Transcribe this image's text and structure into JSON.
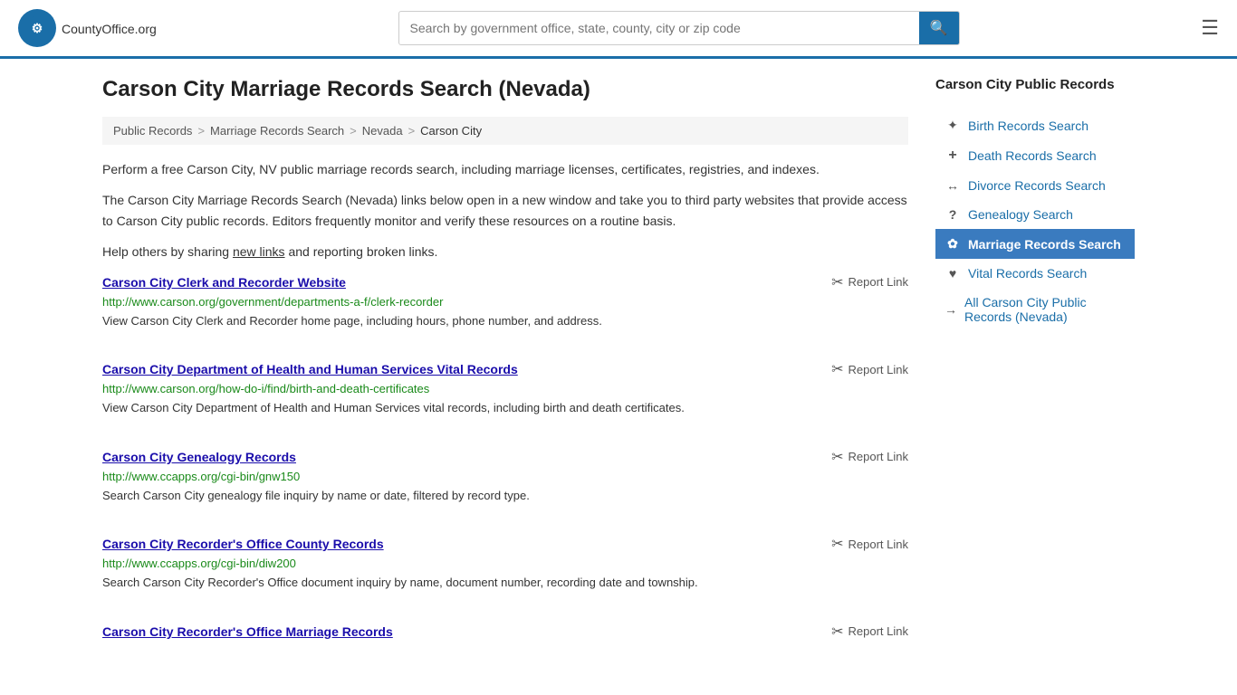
{
  "header": {
    "logo_text": "CountyOffice",
    "logo_suffix": ".org",
    "search_placeholder": "Search by government office, state, county, city or zip code"
  },
  "page": {
    "title": "Carson City Marriage Records Search (Nevada)",
    "breadcrumb": [
      {
        "label": "Public Records",
        "href": "#"
      },
      {
        "label": "Marriage Records Search",
        "href": "#"
      },
      {
        "label": "Nevada",
        "href": "#"
      },
      {
        "label": "Carson City",
        "href": "#",
        "current": true
      }
    ],
    "description1": "Perform a free Carson City, NV public marriage records search, including marriage licenses, certificates, registries, and indexes.",
    "description2": "The Carson City Marriage Records Search (Nevada) links below open in a new window and take you to third party websites that provide access to Carson City public records. Editors frequently monitor and verify these resources on a routine basis.",
    "description3_pre": "Help others by sharing ",
    "description3_link": "new links",
    "description3_post": " and reporting broken links."
  },
  "results": [
    {
      "title": "Carson City Clerk and Recorder Website",
      "url": "http://www.carson.org/government/departments-a-f/clerk-recorder",
      "description": "View Carson City Clerk and Recorder home page, including hours, phone number, and address.",
      "report": "Report Link"
    },
    {
      "title": "Carson City Department of Health and Human Services Vital Records",
      "url": "http://www.carson.org/how-do-i/find/birth-and-death-certificates",
      "description": "View Carson City Department of Health and Human Services vital records, including birth and death certificates.",
      "report": "Report Link"
    },
    {
      "title": "Carson City Genealogy Records",
      "url": "http://www.ccapps.org/cgi-bin/gnw150",
      "description": "Search Carson City genealogy file inquiry by name or date, filtered by record type.",
      "report": "Report Link"
    },
    {
      "title": "Carson City Recorder's Office County Records",
      "url": "http://www.ccapps.org/cgi-bin/diw200",
      "description": "Search Carson City Recorder's Office document inquiry by name, document number, recording date and township.",
      "report": "Report Link"
    },
    {
      "title": "Carson City Recorder's Office Marriage Records",
      "url": "",
      "description": "",
      "report": "Report Link"
    }
  ],
  "sidebar": {
    "title": "Carson City Public Records",
    "items": [
      {
        "label": "Birth Records Search",
        "icon": "birth",
        "active": false
      },
      {
        "label": "Death Records Search",
        "icon": "death",
        "active": false
      },
      {
        "label": "Divorce Records Search",
        "icon": "divorce",
        "active": false
      },
      {
        "label": "Genealogy Search",
        "icon": "genealogy",
        "active": false
      },
      {
        "label": "Marriage Records Search",
        "icon": "marriage",
        "active": true
      },
      {
        "label": "Vital Records Search",
        "icon": "vital",
        "active": false
      },
      {
        "label": "All Carson City Public Records (Nevada)",
        "icon": "all",
        "active": false
      }
    ]
  }
}
